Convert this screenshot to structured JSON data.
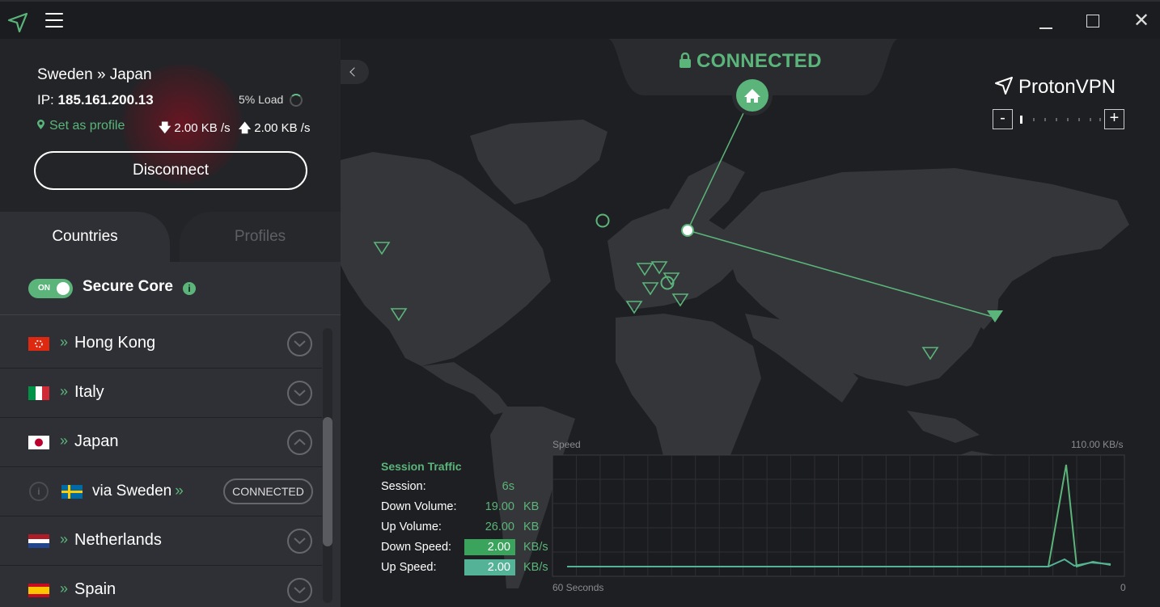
{
  "window": {
    "close_symbol": "✕"
  },
  "connection": {
    "route": "Sweden » Japan",
    "ip_label": "IP:",
    "ip_value": "185.161.200.13",
    "load": "5% Load",
    "set_profile": "Set as profile",
    "down_speed": "2.00 KB /s",
    "up_speed": "2.00 KB /s",
    "disconnect_label": "Disconnect"
  },
  "tabs": {
    "countries": "Countries",
    "profiles": "Profiles"
  },
  "secure_core": {
    "toggle_text": "ON",
    "label": "Secure Core",
    "info": "i"
  },
  "countries": [
    {
      "name": "Hong Kong",
      "chevron": "»",
      "expanded": false
    },
    {
      "name": "Italy",
      "chevron": "»",
      "expanded": false
    },
    {
      "name": "Japan",
      "chevron": "»",
      "expanded": true
    },
    {
      "name": "Netherlands",
      "chevron": "»",
      "expanded": false
    },
    {
      "name": "Spain",
      "chevron": "»",
      "expanded": false
    }
  ],
  "sub_server": {
    "label": "via Sweden",
    "chevron": "»",
    "button": "CONNECTED",
    "info": "i"
  },
  "map": {
    "status": "CONNECTED",
    "brand": "ProtonVPN",
    "zoom_out": "-",
    "zoom_in": "+"
  },
  "traffic": {
    "title": "Session Traffic",
    "session_label": "Session:",
    "session_value": "6s",
    "down_volume_label": "Down Volume:",
    "down_volume_value": "19.00",
    "down_volume_unit": "KB",
    "up_volume_label": "Up Volume:",
    "up_volume_value": "26.00",
    "up_volume_unit": "KB",
    "down_speed_label": "Down Speed:",
    "down_speed_value": "2.00",
    "down_speed_unit": "KB/s",
    "up_speed_label": "Up Speed:",
    "up_speed_value": "2.00",
    "up_speed_unit": "KB/s"
  },
  "speed_chart": {
    "ylabel": "Speed",
    "ymax_label": "110.00  KB/s",
    "xlabel_left": "60 Seconds",
    "xlabel_right": "0"
  },
  "colors": {
    "accent": "#5bb57a",
    "down_box": "#3aa35c",
    "up_box": "#54b397",
    "background": "#1e1f22"
  }
}
